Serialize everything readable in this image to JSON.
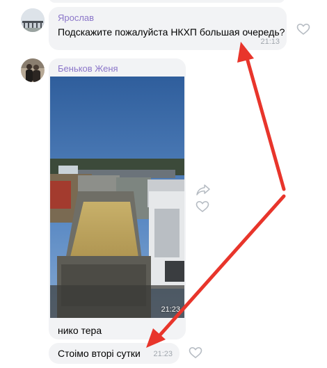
{
  "messages": [
    {
      "sender": "Ярослав",
      "text": "Подскажите пожалуйста НКХП большая очередь?",
      "time": "21:13"
    },
    {
      "sender": "Беньков Женя",
      "photo_time": "21:23",
      "caption": "нико тера"
    },
    {
      "text": "Стоімо вторі сутки",
      "time": "21:23"
    }
  ],
  "icons": {
    "like": "heart-outline-icon",
    "share": "share-arrow-icon"
  },
  "colors": {
    "bubble": "#f2f3f5",
    "sender_name": "#8b76c9",
    "timestamp": "#a0a6ad",
    "annotation_arrow": "#e8352b"
  }
}
